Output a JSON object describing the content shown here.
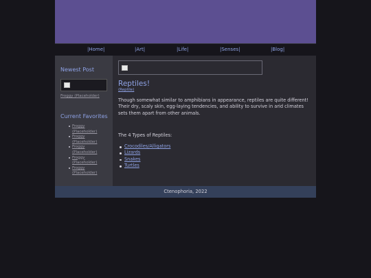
{
  "nav": [
    "|Home|",
    "|Art|",
    "|Life|",
    "|Senses|",
    "|Blog|"
  ],
  "sidebar": {
    "newest_post_heading": "Newest Post",
    "newest_post_link": "Froggy (Placeholder)",
    "favorites_heading": "Current Favorites",
    "favorites": [
      {
        "line1": "Froggy",
        "line2": "(Placeholder)"
      },
      {
        "line1": "Froggy",
        "line2": "(Placeholder)"
      },
      {
        "line1": "Froggy",
        "line2": "(Placeholder)"
      },
      {
        "line1": "Froggy",
        "line2": "(Placeholder)"
      },
      {
        "line1": "Froggy",
        "line2": "(Placeholder)"
      }
    ]
  },
  "post": {
    "title": "Reptiles!",
    "tag": "(Reptile)",
    "body": "Though somewhat similar to amphibians in appearance, reptiles are quite different! Their dry, scaly skin, egg-laying tendencies, and ability to survive in arid climates sets them apart from other animals.",
    "types_heading": "The 4 Types of Reptiles:",
    "types": [
      "Crocodiles/Alligators",
      "Lizards",
      "Snakes",
      "Turtles"
    ]
  },
  "footer": "Ctenophoria, 2022",
  "colors": {
    "banner": "#5c4f91",
    "accent": "#8fa3e6",
    "footer": "#34405a"
  }
}
